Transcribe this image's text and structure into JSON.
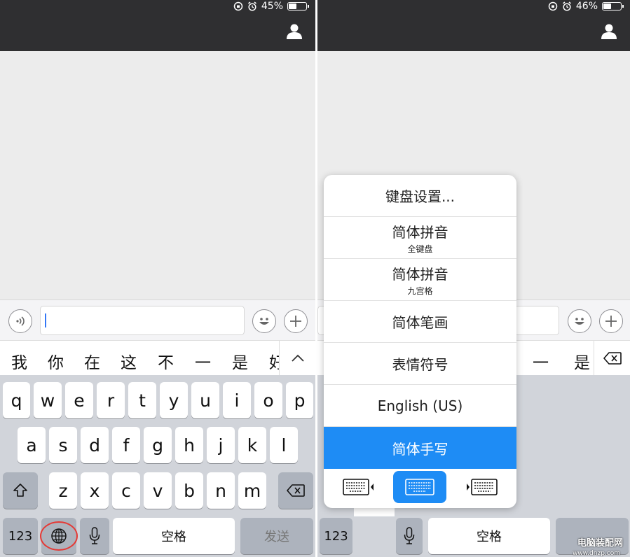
{
  "left_screen": {
    "status": {
      "battery_text": "45%",
      "battery_level": 0.45
    },
    "candidates": [
      "我",
      "你",
      "在",
      "这",
      "不",
      "一",
      "是",
      "好"
    ],
    "keys": {
      "row1": [
        "q",
        "w",
        "e",
        "r",
        "t",
        "y",
        "u",
        "i",
        "o",
        "p"
      ],
      "row2": [
        "a",
        "s",
        "d",
        "f",
        "g",
        "h",
        "j",
        "k",
        "l"
      ],
      "row3": [
        "z",
        "x",
        "c",
        "v",
        "b",
        "n",
        "m"
      ],
      "numbers": "123",
      "space": "空格",
      "send": "发送"
    }
  },
  "right_screen": {
    "status": {
      "battery_text": "46%",
      "battery_level": 0.46
    },
    "candidates": [
      "一",
      "是"
    ],
    "keys": {
      "numbers": "123",
      "space": "空格"
    },
    "menu": {
      "settings": "键盘设置...",
      "items": [
        {
          "main": "简体拼音",
          "sub": "全键盘"
        },
        {
          "main": "简体拼音",
          "sub": "九宫格"
        },
        {
          "main": "简体笔画",
          "sub": ""
        },
        {
          "main": "表情符号",
          "sub": ""
        },
        {
          "main": "English (US)",
          "sub": ""
        },
        {
          "main": "简体手写",
          "sub": ""
        }
      ],
      "active_color": "#1e8cf5"
    }
  },
  "watermark": {
    "title": "电脑装配网",
    "url": "www.dnzp.com"
  },
  "colors": {
    "status_bar": "#2f2f31",
    "keyboard_bg": "#d1d4da",
    "accent": "#1e8cf5",
    "highlight_ring": "#e53935"
  }
}
